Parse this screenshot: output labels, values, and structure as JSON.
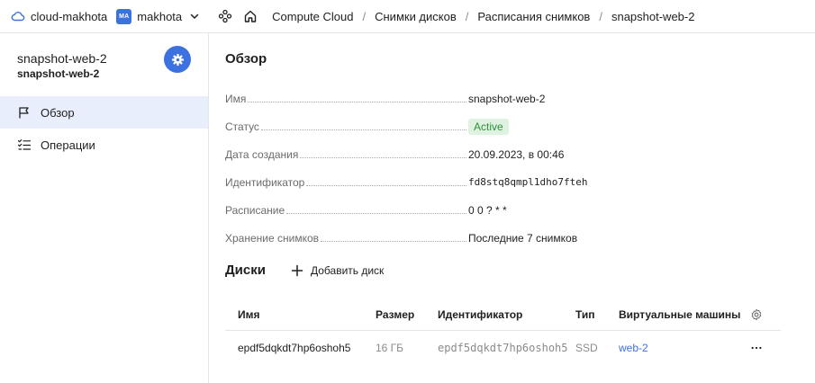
{
  "header": {
    "cloud": "cloud-makhota",
    "folder_badge": "MA",
    "folder": "makhota",
    "breadcrumbs": [
      "Compute Cloud",
      "Снимки дисков",
      "Расписания снимков",
      "snapshot-web-2"
    ]
  },
  "sidebar": {
    "title": "snapshot-web-2",
    "subtitle": "snapshot-web-2",
    "items": [
      {
        "label": "Обзор",
        "active": true
      },
      {
        "label": "Операции",
        "active": false
      }
    ]
  },
  "overview": {
    "title": "Обзор",
    "props": [
      {
        "label": "Имя",
        "value": "snapshot-web-2"
      },
      {
        "label": "Статус",
        "value": "Active"
      },
      {
        "label": "Дата создания",
        "value": "20.09.2023, в 00:46"
      },
      {
        "label": "Идентификатор",
        "value": "fd8stq8qmpl1dho7fteh"
      },
      {
        "label": "Расписание",
        "value": "0 0 ? * *"
      },
      {
        "label": "Хранение снимков",
        "value": "Последние 7 снимков"
      }
    ]
  },
  "disks": {
    "title": "Диски",
    "add_label": "Добавить диск",
    "columns": [
      "Имя",
      "Размер",
      "Идентификатор",
      "Тип",
      "Виртуальные машины"
    ],
    "rows": [
      {
        "name": "epdf5dqkdt7hp6oshoh5",
        "size": "16 ГБ",
        "id": "epdf5dqkdt7hp6oshoh5",
        "type": "SSD",
        "vm": "web-2"
      }
    ]
  },
  "colors": {
    "accent": "#3c71e0",
    "status_bg": "#dff2e1",
    "status_text": "#2f8f3a",
    "active_bg": "#e8eefb"
  }
}
